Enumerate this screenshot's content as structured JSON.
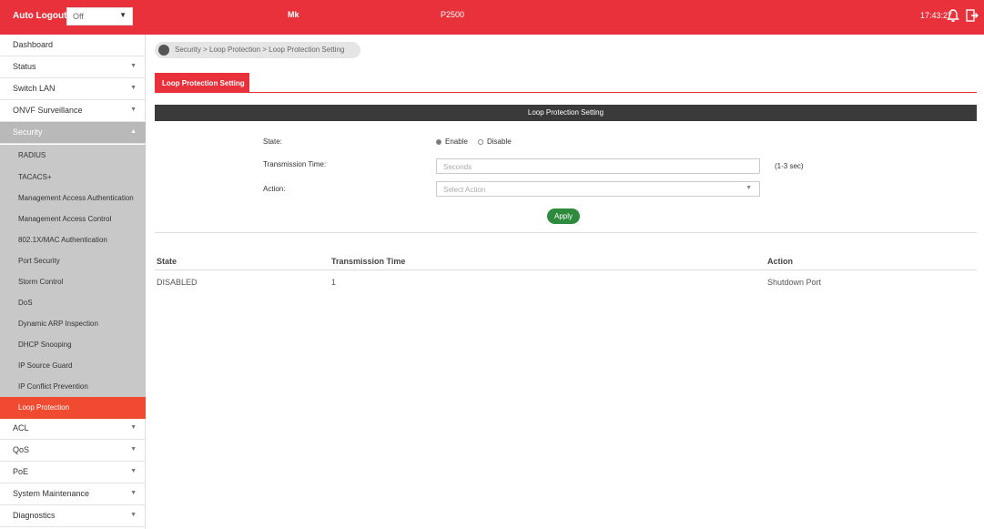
{
  "topbar": {
    "auto_logout_label": "Auto Logout",
    "auto_logout_value": "Off",
    "model": "Mk",
    "device": "P2500",
    "time": "17:43:27"
  },
  "sidebar": {
    "items": [
      {
        "label": "Dashboard"
      },
      {
        "label": "Status"
      },
      {
        "label": "Switch LAN"
      },
      {
        "label": "ONVF Surveillance"
      },
      {
        "label": "Security"
      }
    ],
    "security_sub": [
      {
        "label": "RADIUS"
      },
      {
        "label": "TACACS+"
      },
      {
        "label": "Management Access Authentication"
      },
      {
        "label": "Management Access Control"
      },
      {
        "label": "802.1X/MAC Authentication"
      },
      {
        "label": "Port Security"
      },
      {
        "label": "Storm Control"
      },
      {
        "label": "DoS"
      },
      {
        "label": "Dynamic ARP Inspection"
      },
      {
        "label": "DHCP Snooping"
      },
      {
        "label": "IP Source Guard"
      },
      {
        "label": "IP Conflict Prevention"
      },
      {
        "label": "Loop Protection"
      }
    ],
    "items_after": [
      {
        "label": "ACL"
      },
      {
        "label": "QoS"
      },
      {
        "label": "PoE"
      },
      {
        "label": "System Maintenance"
      },
      {
        "label": "Diagnostics"
      }
    ]
  },
  "breadcrumb": "Security > Loop Protection > Loop Protection Setting",
  "tab_label": "Loop Protection Setting",
  "panel": {
    "title": "Loop Protection Setting",
    "state_label": "State:",
    "state_enable": "Enable",
    "state_disable": "Disable",
    "transmission_label": "Transmission Time:",
    "transmission_placeholder": "Seconds",
    "transmission_hint": "(1-3 sec)",
    "action_label": "Action:",
    "action_placeholder": "Select Action",
    "apply": "Apply"
  },
  "table": {
    "headers": [
      "State",
      "Transmission Time",
      "Action"
    ],
    "rows": [
      [
        "DISABLED",
        "1",
        "Shutdown Port"
      ]
    ]
  },
  "colors": {
    "accent": "#e8313a",
    "apply": "#2e8b3e",
    "panel": "#3a3a3a"
  }
}
